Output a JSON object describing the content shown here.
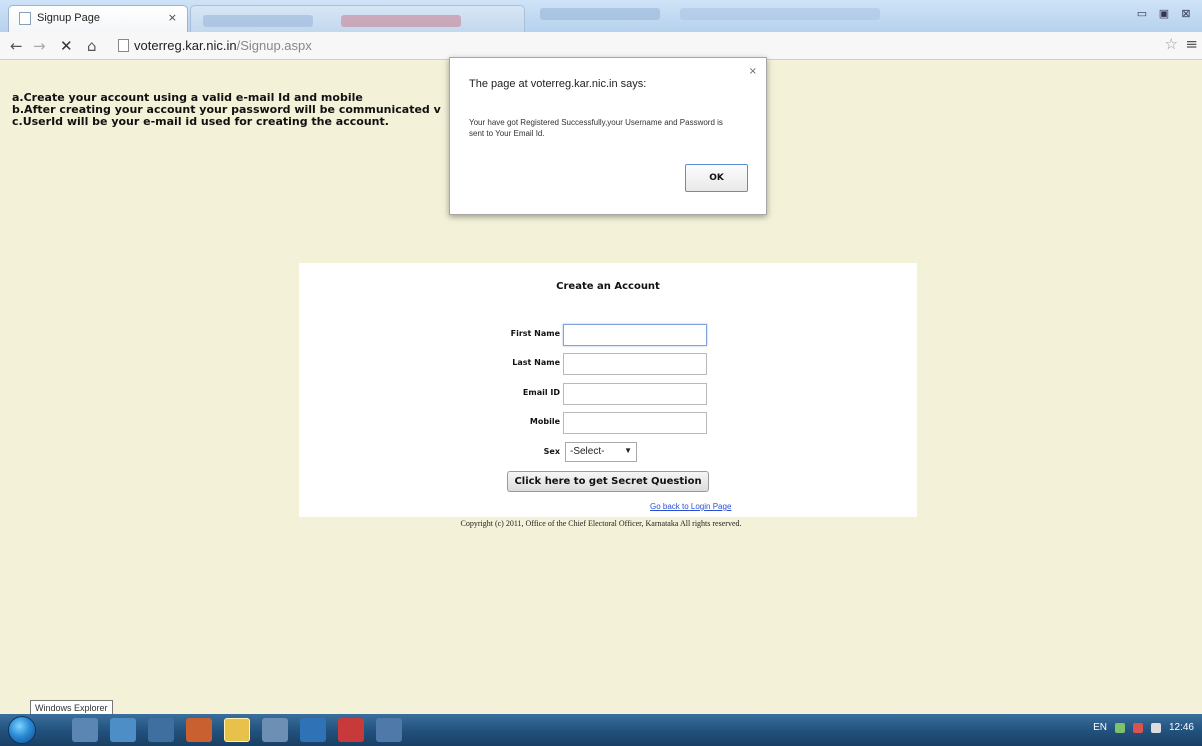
{
  "browser": {
    "active_tab_title": "Signup Page",
    "tab_close": "×",
    "url_host": "voterreg.kar.nic.in",
    "url_path": "/Signup.aspx",
    "window_controls": [
      "▭",
      "▣",
      "⊠"
    ],
    "icons": {
      "back": "back-arrow-icon",
      "forward": "forward-arrow-icon",
      "stop": "close-icon",
      "home": "home-icon",
      "bookmark": "star-icon",
      "menu": "menu-icon"
    }
  },
  "instructions": {
    "line_a": "a.Create your account using a valid e-mail Id and mobile",
    "line_b": "b.After creating your account your password will be communicated v",
    "line_c": "c.UserId will be your e-mail id used for creating the account."
  },
  "form": {
    "title": "Create an Account",
    "first_name_label": "First Name",
    "last_name_label": "Last Name",
    "email_label": "Email ID",
    "mobile_label": "Mobile",
    "sex_label": "Sex",
    "first_name_value": "",
    "last_name_value": "",
    "email_value": "",
    "mobile_value": "",
    "sex_selected": "-Select-",
    "secret_button": "Click here to get Secret Question",
    "back_link": "Go back to Login Page"
  },
  "copyright": "Copyright (c) 2011, Office of the Chief Electoral Officer, Karnataka All rights reserved.",
  "dialog": {
    "title": "The page at voterreg.kar.nic.in says:",
    "message": "Your have got Registered Successfully,your Username and Password is sent to Your Email Id.",
    "ok": "OK",
    "close": "×"
  },
  "tooltip": "Windows Explorer",
  "taskbar": {
    "language": "EN",
    "clock": "12:46"
  },
  "colors": {
    "page_background": "#f3f1d8",
    "link": "#2a4fd6",
    "taskbar": "#21507c"
  }
}
